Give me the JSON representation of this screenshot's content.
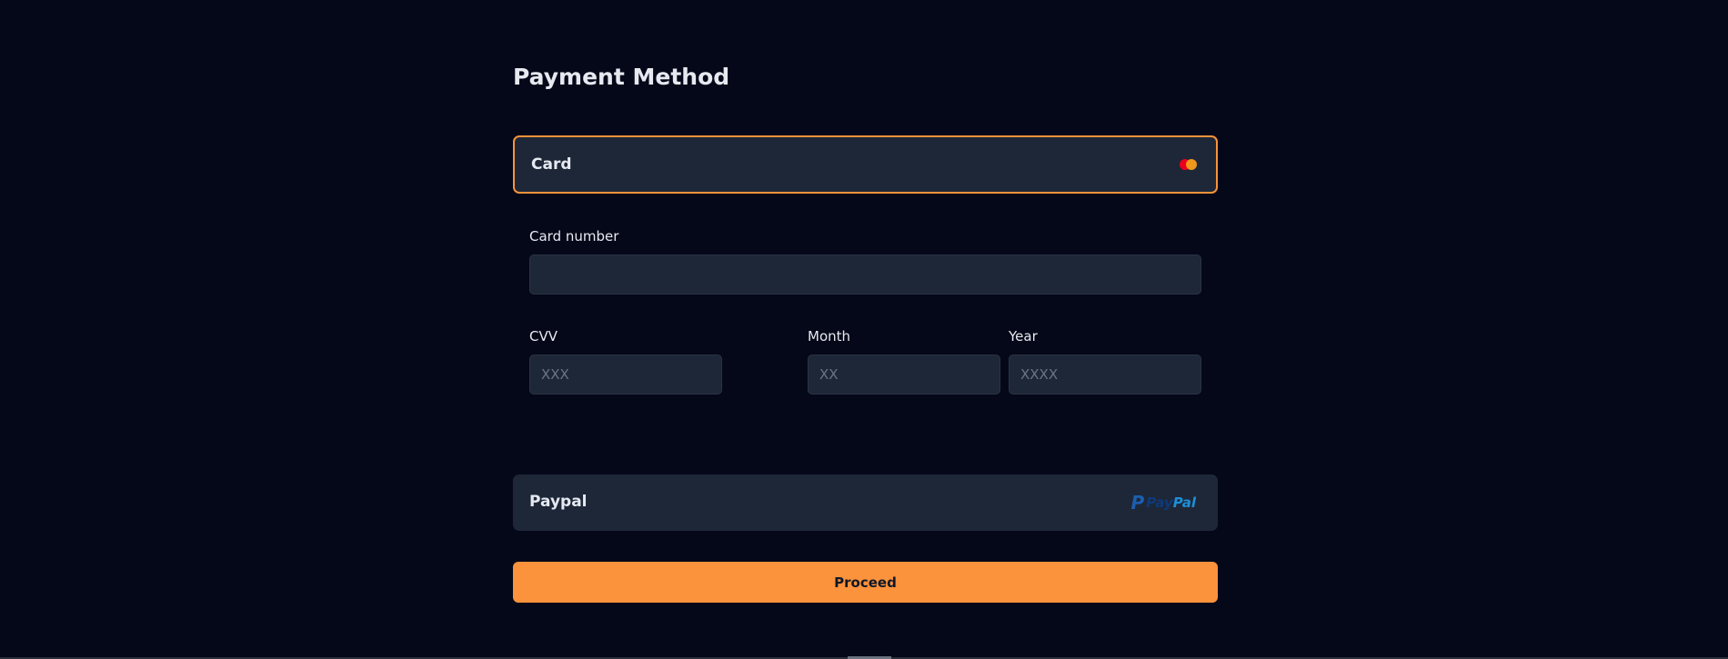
{
  "page": {
    "title": "Payment Method"
  },
  "methods": {
    "card": {
      "label": "Card",
      "icon": "mastercard-icon",
      "selected": true
    },
    "paypal": {
      "label": "Paypal",
      "icon": "paypal-logo",
      "logo_text_pay": "Pay",
      "logo_text_pal": "Pal"
    }
  },
  "form": {
    "card_number": {
      "label": "Card number",
      "value": "",
      "placeholder": ""
    },
    "cvv": {
      "label": "CVV",
      "value": "",
      "placeholder": "XXX"
    },
    "month": {
      "label": "Month",
      "value": "",
      "placeholder": "XX"
    },
    "year": {
      "label": "Year",
      "value": "",
      "placeholder": "XXXX"
    }
  },
  "actions": {
    "proceed_label": "Proceed"
  },
  "colors": {
    "background": "#050818",
    "surface": "#1e2738",
    "accent": "#fb923c",
    "selected_border": "#f89339"
  }
}
